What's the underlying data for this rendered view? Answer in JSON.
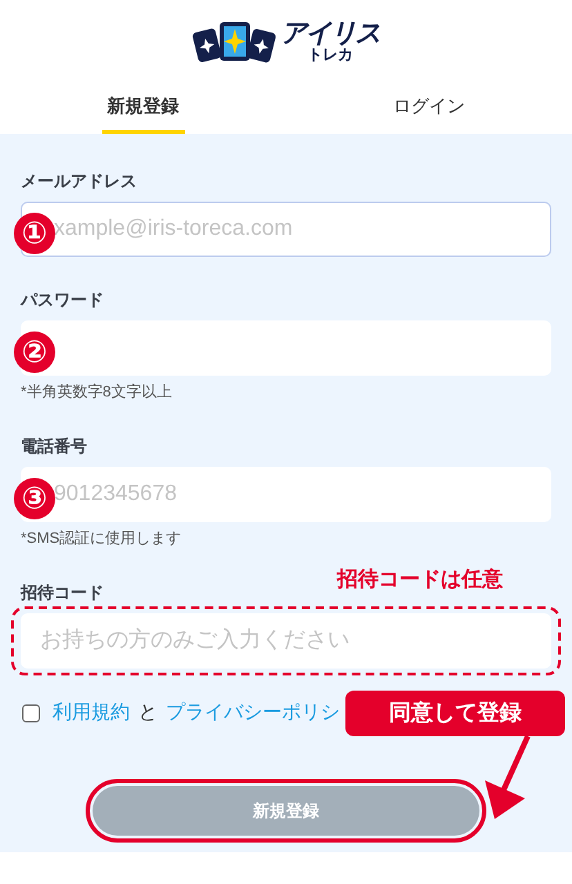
{
  "logo": {
    "name": "アイリス",
    "sub": "トレカ"
  },
  "tabs": [
    {
      "label": "新規登録",
      "selected": true
    },
    {
      "label": "ログイン",
      "selected": false
    }
  ],
  "fields": [
    {
      "label": "メールアドレス",
      "placeholder": "xample@iris-toreca.com",
      "focused": true,
      "marker": "①"
    },
    {
      "label": "パスワード",
      "hint": "*半角英数字8文字以上",
      "focused": false,
      "marker": "②"
    },
    {
      "label": "電話番号",
      "placeholder": "9012345678",
      "hint": "*SMS認証に使用します",
      "focused": false,
      "marker": "③"
    },
    {
      "label": "招待コード",
      "placeholder": "お持ちの方のみご入力ください",
      "focused": false,
      "note": "招待コードは任意"
    }
  ],
  "terms": {
    "checked": false,
    "parts": [
      {
        "kind": "link",
        "text": "利用規約"
      },
      {
        "kind": "text",
        "text": "と"
      },
      {
        "kind": "link",
        "text": "プライバシーポリシ"
      }
    ]
  },
  "submit": {
    "label": "新規登録",
    "disabled": true,
    "note": "同意して登録"
  }
}
